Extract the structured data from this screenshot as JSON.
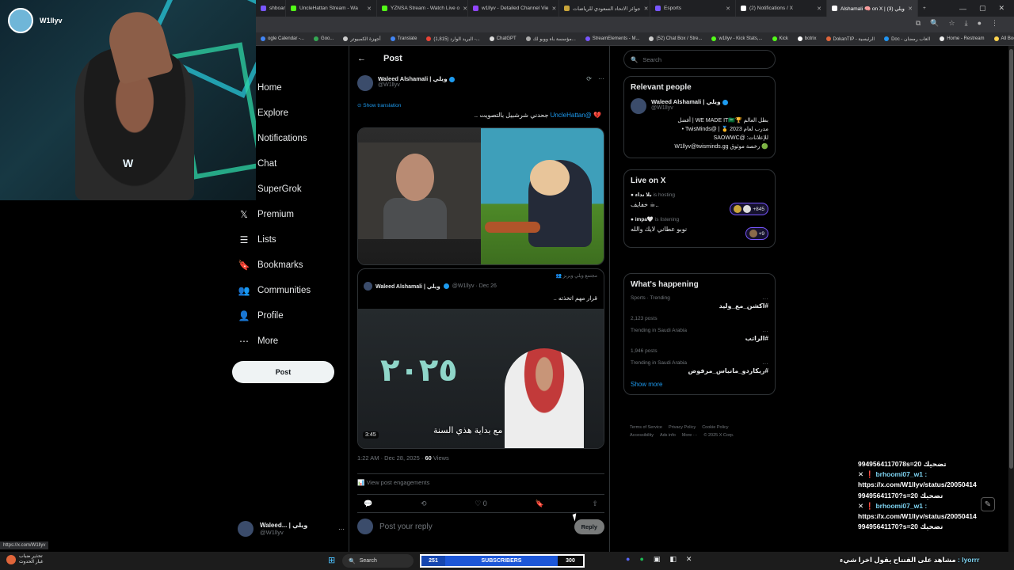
{
  "browser": {
    "tabs": [
      {
        "title": "shboard",
        "color": "#7856ff",
        "active": false
      },
      {
        "title": "UncleHattan Stream - Wa",
        "color": "#53fc18",
        "active": false
      },
      {
        "title": "YZNSA Stream - Watch Live o",
        "color": "#53fc18",
        "active": false
      },
      {
        "title": "w1llyv - Detailed Channel Vie",
        "color": "#9146ff",
        "active": false
      },
      {
        "title": "جوائز الاتحاد السعودي للرياضات",
        "color": "#c9a53a",
        "active": false
      },
      {
        "title": "Esports",
        "color": "#7856ff",
        "active": false
      },
      {
        "title": "(2) Notifications / X",
        "color": "#ffffff",
        "active": false
      },
      {
        "title": "Alshamali 🧠 on X | ويلي (3)",
        "color": "#ffffff",
        "active": true
      }
    ],
    "new_tab": "+",
    "bookmarks": [
      "ogle Calendar -...",
      "Goo...",
      "أجهزة الكمبيوتر",
      "Translate",
      "(1,815) البريد الوارد -...",
      "ChatGPT",
      "مؤسسة باه ووبو لك...",
      "StreamElements - M...",
      "(52) Chat Box / Stre...",
      "w1llyv - Kick Stats,...",
      "Kick",
      "botrix",
      "DokanTIP - الرئيسية",
      "Doc - العاب رمضان",
      "Home - Restream",
      "All Bookmarks"
    ]
  },
  "webcam": {
    "streamer_name": "W1llyv"
  },
  "nav": {
    "items": [
      {
        "label": "Home",
        "icon": "home-icon",
        "glyph": ""
      },
      {
        "label": "Explore",
        "icon": "search-icon",
        "glyph": ""
      },
      {
        "label": "Notifications",
        "icon": "bell-icon",
        "glyph": ""
      },
      {
        "label": "Chat",
        "icon": "mail-icon",
        "glyph": ""
      },
      {
        "label": "SuperGrok",
        "icon": "grok-icon",
        "glyph": ""
      },
      {
        "label": "Premium",
        "icon": "x-logo-icon",
        "glyph": "𝕏"
      },
      {
        "label": "Lists",
        "icon": "list-icon",
        "glyph": "☰"
      },
      {
        "label": "Bookmarks",
        "icon": "bookmark-icon",
        "glyph": "🔖"
      },
      {
        "label": "Communities",
        "icon": "people-icon",
        "glyph": "👥"
      },
      {
        "label": "Profile",
        "icon": "person-icon",
        "glyph": "👤"
      },
      {
        "label": "More",
        "icon": "more-circle-icon",
        "glyph": "⋯"
      }
    ],
    "post_button": "Post",
    "account": {
      "name": "Waleed... | ويلي",
      "handle": "@W1llyv",
      "more": "···"
    }
  },
  "status_url": "https://x.com/W1llyv",
  "post": {
    "header_title": "Post",
    "author_name": "Waleed Alshamali | ويلي",
    "author_handle": "@W1llyv",
    "show_translation": "Show translation",
    "text": "جحدني شرشبيل بالتصويت ..",
    "mention": "@UncleHattan",
    "quote": {
      "community": "مجتمع ويلي ويربز",
      "author_name": "Waleed Alshamali | ويلي",
      "meta": "@W1llyv · Dec 26",
      "text": "قرار مهم اتخذته ..",
      "video_glyph": "٢٠٢٥",
      "subtitle": "مع بداية هذي السنة",
      "duration": "3:45"
    },
    "timestamp": "1:22 AM · Dec 28, 2025 ·",
    "views_count": "60",
    "views_label": "Views",
    "engagements": "View post engagements",
    "like_count": "0",
    "reply_placeholder": "Post your reply",
    "reply_button": "Reply"
  },
  "sidebar": {
    "search_placeholder": "Search",
    "relevant_title": "Relevant people",
    "relevant_name": "Waleed Alshamali | ويلي",
    "relevant_handle": "@W1llyv",
    "bio_line1": "بطل العالم 🏆WE MADE IT🇸🇦 | أفضل",
    "bio_line2": "مدرب لعام 2023 🥇 | @TwisMinds •",
    "bio_line3": "للإعلانات: @SAOWWC",
    "bio_line4": "🟢 رخصة موثوق W1llyv@twisminds.gg",
    "live_title": "Live on X",
    "live1_who": "بلا نداء",
    "live1_status": "is hosting",
    "live1_title": "خفايف ☕..",
    "live1_count": "+845",
    "live2_who": "impa🤍",
    "live2_status": "is listening",
    "live2_title": "نوبو عطاني لايك والله",
    "live2_count": "+9",
    "happening_title": "What's happening",
    "trends": [
      {
        "cat": "Sports · Trending",
        "tag": "#اكشن_مع_وليد",
        "cnt": "2,123 posts"
      },
      {
        "cat": "Trending in Saudi Arabia",
        "tag": "#الراتب",
        "cnt": "1,946 posts"
      },
      {
        "cat": "Trending in Saudi Arabia",
        "tag": "#ريكاردو_مانياس_مرفوض",
        "cnt": ""
      }
    ],
    "show_more": "Show more",
    "footer": [
      "Terms of Service",
      "Privacy Policy",
      "Cookie Policy",
      "Accessibility",
      "Ads info",
      "More ···",
      "© 2025 X Corp."
    ]
  },
  "chat": {
    "line0": "9949564117078s=20 تضحيك",
    "user1": "brhoomi07_w1 :",
    "url1": "https://x.com/W1llyv/status/20050414",
    "url1b": "99495641170?s=20 تضحيك",
    "user2": "brhoomi07_w1 :",
    "url2": "https://x.com/W1llyv/status/20050414",
    "url2b": "99495641170?s=20 تضحيك"
  },
  "taskbar": {
    "weather_line1": "تحذير ضباب",
    "weather_line2": "غبار الحدوث",
    "search": "Search",
    "sub_left": "251",
    "sub_mid": "SUBSCRIBERS",
    "sub_right": "300",
    "ticker_user": "lyorrr :",
    "ticker_text": "مشاهد على الفتتاح يقول اخرا شيء"
  }
}
